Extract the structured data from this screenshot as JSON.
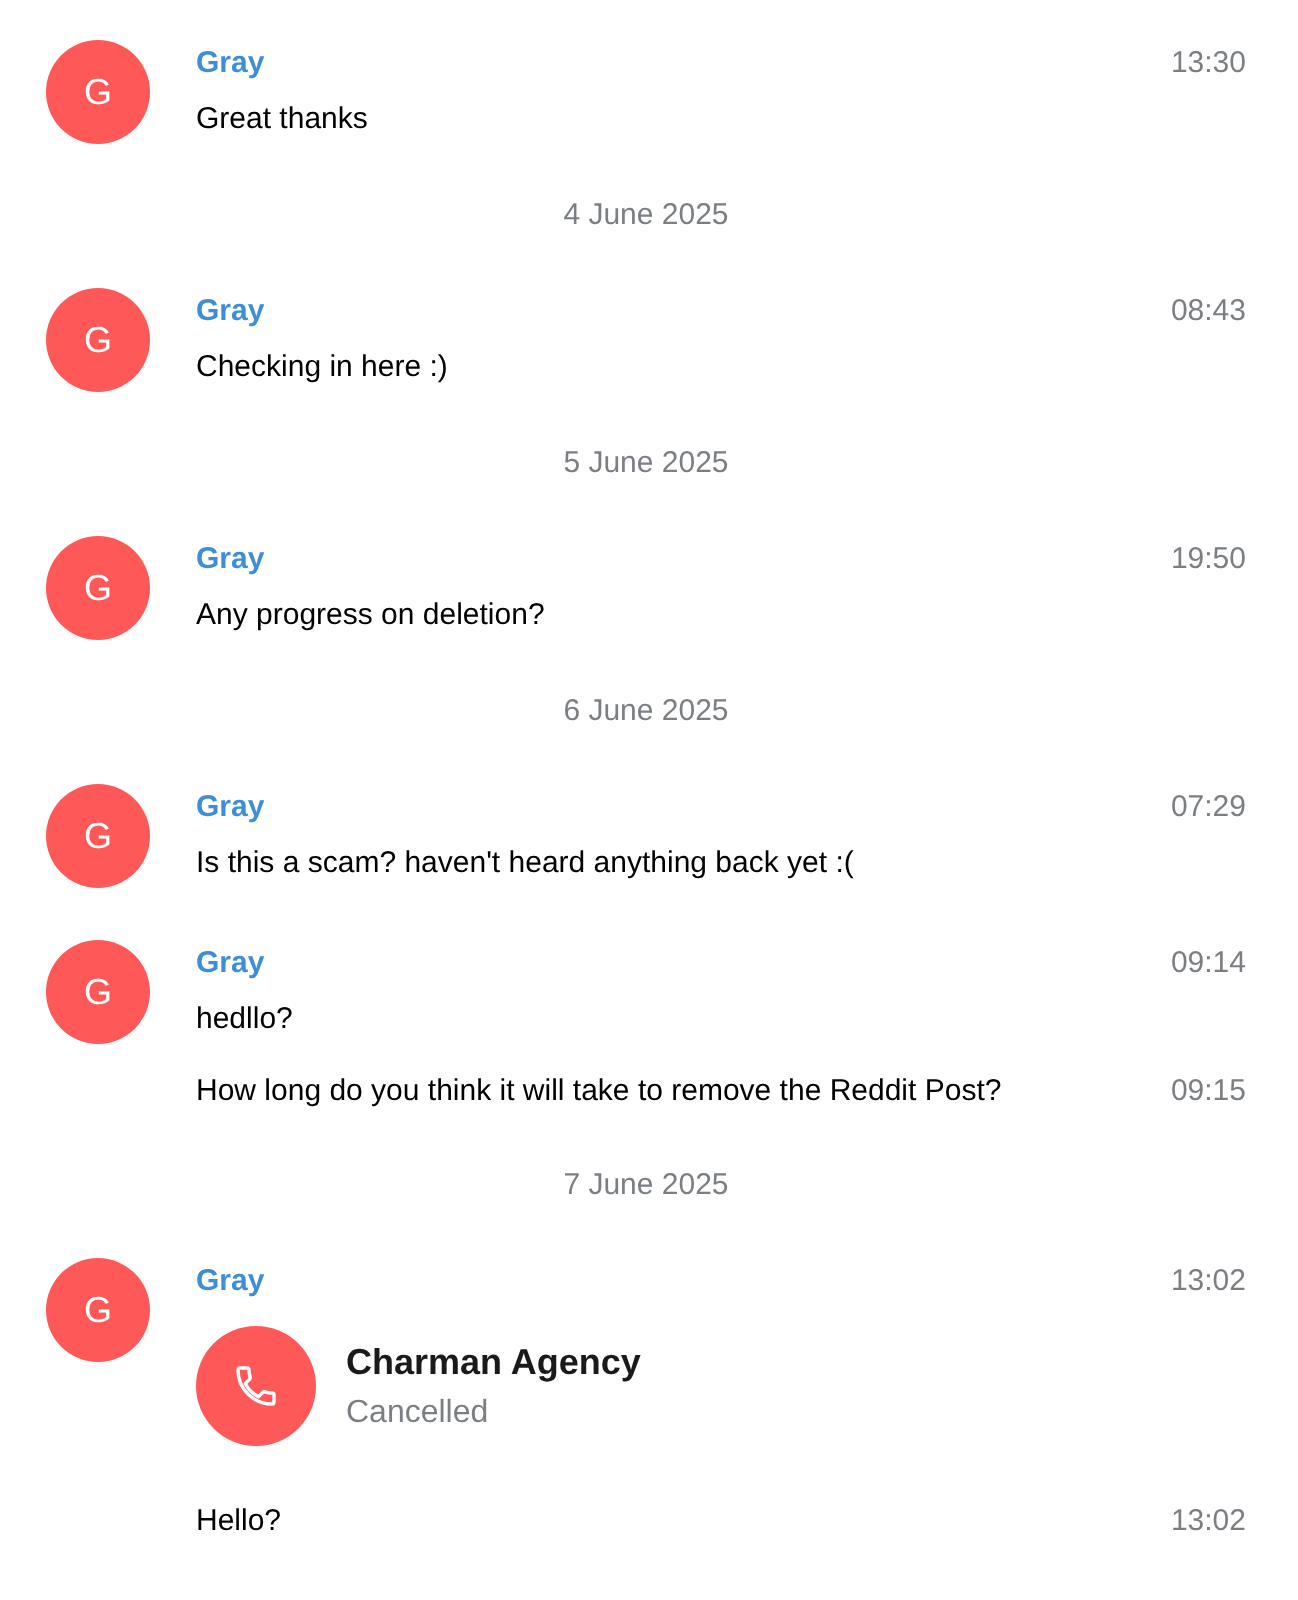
{
  "items": [
    {
      "kind": "message_group",
      "avatar": "G",
      "sender": "Gray",
      "time": "13:30",
      "messages": [
        {
          "kind": "text",
          "text": "Great thanks"
        }
      ]
    },
    {
      "kind": "date",
      "label": "4 June 2025"
    },
    {
      "kind": "message_group",
      "avatar": "G",
      "sender": "Gray",
      "time": "08:43",
      "messages": [
        {
          "kind": "text",
          "text": "Checking in here :)"
        }
      ]
    },
    {
      "kind": "date",
      "label": "5 June 2025"
    },
    {
      "kind": "message_group",
      "avatar": "G",
      "sender": "Gray",
      "time": "19:50",
      "messages": [
        {
          "kind": "text",
          "text": "Any progress on deletion?"
        }
      ]
    },
    {
      "kind": "date",
      "label": "6 June 2025"
    },
    {
      "kind": "message_group",
      "avatar": "G",
      "sender": "Gray",
      "time": "07:29",
      "messages": [
        {
          "kind": "text",
          "text": "Is this a scam? haven't heard anything back yet :("
        }
      ]
    },
    {
      "kind": "message_group",
      "avatar": "G",
      "sender": "Gray",
      "time": "09:14",
      "messages": [
        {
          "kind": "text",
          "text": "hedllo?"
        },
        {
          "kind": "text",
          "text": "How long do you think it will take to remove the Reddit Post?",
          "time": "09:15"
        }
      ]
    },
    {
      "kind": "date",
      "label": "7 June 2025"
    },
    {
      "kind": "message_group",
      "avatar": "G",
      "sender": "Gray",
      "time": "13:02",
      "messages": [
        {
          "kind": "call",
          "title": "Charman Agency",
          "status": "Cancelled"
        },
        {
          "kind": "text",
          "text": "Hello?",
          "time": "13:02"
        }
      ]
    }
  ]
}
